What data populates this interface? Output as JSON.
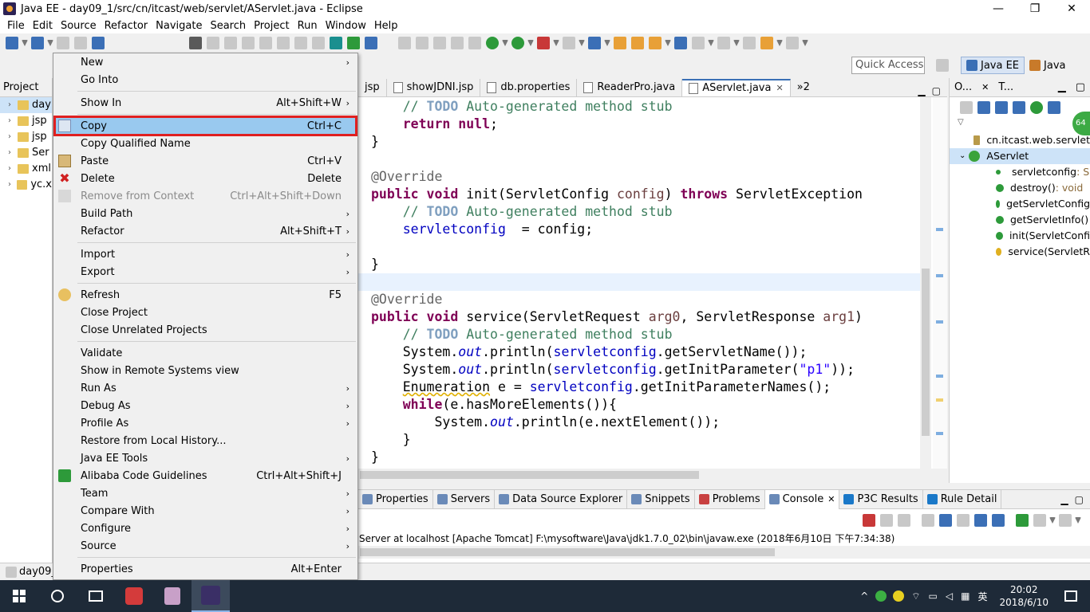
{
  "window": {
    "title": "Java EE - day09_1/src/cn/itcast/web/servlet/AServlet.java - Eclipse",
    "minimize": "—",
    "maximize": "❐",
    "close": "✕"
  },
  "menubar": [
    "File",
    "Edit",
    "Source",
    "Refactor",
    "Navigate",
    "Search",
    "Project",
    "Run",
    "Window",
    "Help"
  ],
  "perspective": {
    "quick_access_placeholder": "Quick Access",
    "java_ee": "Java EE",
    "java": "Java"
  },
  "project_explorer": {
    "tab": "Project",
    "items": [
      "day",
      "jsp",
      "jsp",
      "Ser",
      "xml",
      "yc.x"
    ]
  },
  "editor": {
    "tabs": [
      "jsp",
      "showJDNI.jsp",
      "db.properties",
      "ReaderPro.java",
      "AServlet.java",
      "»2"
    ],
    "close_glyph": "✕",
    "lines": {
      "l1": {
        "todo": "TODO",
        "rest": " Auto-generated method stub"
      },
      "l2": {
        "kw": "return",
        "kw2": "null",
        "tail": ";"
      },
      "l3": "}",
      "l5": "@Override",
      "l6": {
        "kw1": "public",
        "kw2": "void",
        "name": " init(ServletConfig ",
        "param": "config",
        "close": ") ",
        "kw3": "throws",
        "exc": " ServletException"
      },
      "l7": {
        "todo": "TODO",
        "rest": " Auto-generated method stub"
      },
      "l8": {
        "field": "servletconfig",
        "rest": "  = config;"
      },
      "l10": "}",
      "l12": "@Override",
      "l13": {
        "kw1": "public",
        "kw2": "void",
        "name": " service(ServletRequest ",
        "p1": "arg0",
        "mid": ", ServletResponse ",
        "p2": "arg1",
        "end": ")"
      },
      "l14": {
        "todo": "TODO",
        "rest": " Auto-generated method stub"
      },
      "l15": {
        "a": "System.",
        "out": "out",
        "b": ".println(",
        "field": "servletconfig",
        "c": ".getServletName());"
      },
      "l16": {
        "a": "System.",
        "out": "out",
        "b": ".println(",
        "field": "servletconfig",
        "c": ".getInitParameter(",
        "str": "\"p1\"",
        "d": "));"
      },
      "l17": {
        "type": "Enumeration",
        "var": " e = ",
        "field": "servletconfig",
        "c": ".getInitParameterNames();"
      },
      "l18": {
        "kw": "while",
        "rest": "(e.hasMoreElements()){"
      },
      "l19": {
        "a": "System.",
        "out": "out",
        "b": ".println(e.nextElement());"
      },
      "l20": "}",
      "l21": "}"
    }
  },
  "outline": {
    "tab1": "O...",
    "tab2": "T...",
    "badge": "64",
    "items": [
      {
        "label": "cn.itcast.web.servlet",
        "type": ""
      },
      {
        "label": "AServlet",
        "type": ""
      },
      {
        "label": "servletconfig",
        "type": " : S"
      },
      {
        "label": "destroy()",
        "type": " : void"
      },
      {
        "label": "getServletConfig",
        "type": ""
      },
      {
        "label": "getServletInfo()",
        "type": ""
      },
      {
        "label": "init(ServletConfi",
        "type": ""
      },
      {
        "label": "service(ServletR",
        "type": ""
      }
    ]
  },
  "console": {
    "tabs": [
      "Properties",
      "Servers",
      "Data Source Explorer",
      "Snippets",
      "Problems",
      "Console",
      "P3C Results",
      "Rule Detail"
    ],
    "status": "Server at localhost [Apache Tomcat] F:\\mysoftware\\Java\\jdk1.7.0_02\\bin\\javaw.exe (2018年6月10日 下午7:34:38)"
  },
  "statusbar": {
    "text": "day09_"
  },
  "context_menu": {
    "items": [
      {
        "label": "New",
        "shortcut": "",
        "submenu": true
      },
      {
        "label": "Go Into",
        "shortcut": ""
      },
      {
        "label": "Show In",
        "shortcut": "Alt+Shift+W",
        "submenu": true
      },
      {
        "label": "Copy",
        "shortcut": "Ctrl+C"
      },
      {
        "label": "Copy Qualified Name",
        "shortcut": ""
      },
      {
        "label": "Paste",
        "shortcut": "Ctrl+V"
      },
      {
        "label": "Delete",
        "shortcut": "Delete"
      },
      {
        "label": "Remove from Context",
        "shortcut": "Ctrl+Alt+Shift+Down"
      },
      {
        "label": "Build Path",
        "shortcut": "",
        "submenu": true
      },
      {
        "label": "Refactor",
        "shortcut": "Alt+Shift+T",
        "submenu": true
      },
      {
        "label": "Import",
        "shortcut": "",
        "submenu": true
      },
      {
        "label": "Export",
        "shortcut": "",
        "submenu": true
      },
      {
        "label": "Refresh",
        "shortcut": "F5"
      },
      {
        "label": "Close Project",
        "shortcut": ""
      },
      {
        "label": "Close Unrelated Projects",
        "shortcut": ""
      },
      {
        "label": "Validate",
        "shortcut": ""
      },
      {
        "label": "Show in Remote Systems view",
        "shortcut": ""
      },
      {
        "label": "Run As",
        "shortcut": "",
        "submenu": true
      },
      {
        "label": "Debug As",
        "shortcut": "",
        "submenu": true
      },
      {
        "label": "Profile As",
        "shortcut": "",
        "submenu": true
      },
      {
        "label": "Restore from Local History...",
        "shortcut": ""
      },
      {
        "label": "Java EE Tools",
        "shortcut": "",
        "submenu": true
      },
      {
        "label": "Alibaba Code Guidelines",
        "shortcut": "Ctrl+Alt+Shift+J"
      },
      {
        "label": "Team",
        "shortcut": "",
        "submenu": true
      },
      {
        "label": "Compare With",
        "shortcut": "",
        "submenu": true
      },
      {
        "label": "Configure",
        "shortcut": "",
        "submenu": true
      },
      {
        "label": "Source",
        "shortcut": "",
        "submenu": true
      },
      {
        "label": "Properties",
        "shortcut": "Alt+Enter"
      }
    ],
    "selected": "Copy",
    "disabled": "Remove from Context",
    "arrow": "›"
  },
  "taskbar": {
    "ime": "英",
    "time": "20:02",
    "date": "2018/6/10"
  }
}
